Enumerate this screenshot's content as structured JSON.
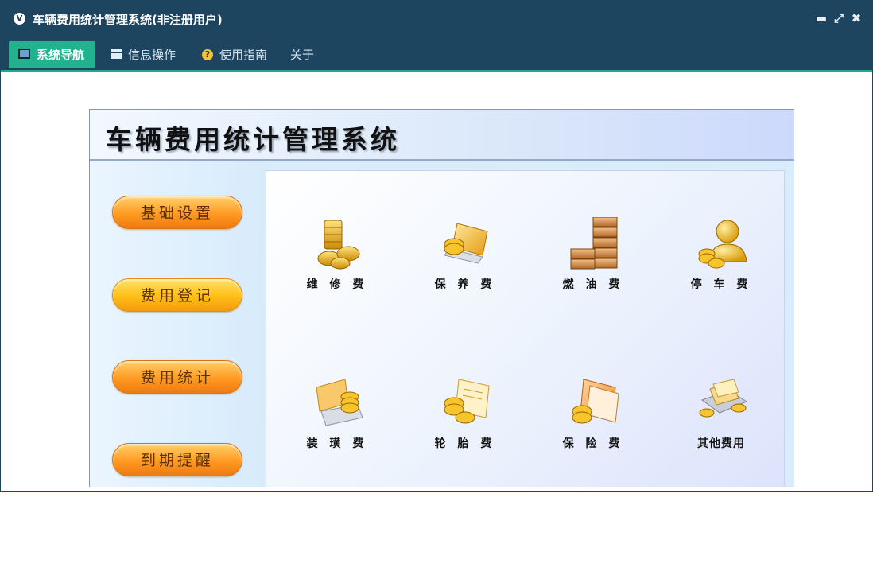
{
  "titlebar": {
    "title": "车辆费用统计管理系统(非注册用户)",
    "icon": "app-logo-icon",
    "controls": [
      "minimize-icon",
      "restore-icon",
      "close-icon"
    ]
  },
  "menu": {
    "items": [
      {
        "label": "系统导航",
        "icon": "navigation-icon",
        "active": true
      },
      {
        "label": "信息操作",
        "icon": "grid-icon",
        "active": false
      },
      {
        "label": "使用指南",
        "icon": "help-icon",
        "active": false
      },
      {
        "label": "关于",
        "icon": "",
        "active": false
      }
    ]
  },
  "banner": {
    "title": "车辆费用统计管理系统"
  },
  "sidebar": {
    "buttons": [
      {
        "label": "基础设置"
      },
      {
        "label": "费用登记"
      },
      {
        "label": "费用统计"
      },
      {
        "label": "到期提醒"
      }
    ]
  },
  "fees": {
    "items": [
      {
        "label": "维 修 费",
        "icon": "coin-stack-icon"
      },
      {
        "label": "保 养 费",
        "icon": "laptop-coins-icon"
      },
      {
        "label": "燃 油 费",
        "icon": "bar-stack-icon"
      },
      {
        "label": "停 车 费",
        "icon": "person-coins-icon"
      },
      {
        "label": "装 璜 费",
        "icon": "card-coins-icon"
      },
      {
        "label": "轮 胎 费",
        "icon": "document-coins-icon"
      },
      {
        "label": "保 险 费",
        "icon": "folder-coins-icon"
      },
      {
        "label": "其他费用",
        "icon": "cash-tray-icon"
      }
    ]
  },
  "colors": {
    "titlebar_bg": "#1d4560",
    "menu_active_bg": "#23b28f",
    "accent_gold": "#f5b418"
  }
}
